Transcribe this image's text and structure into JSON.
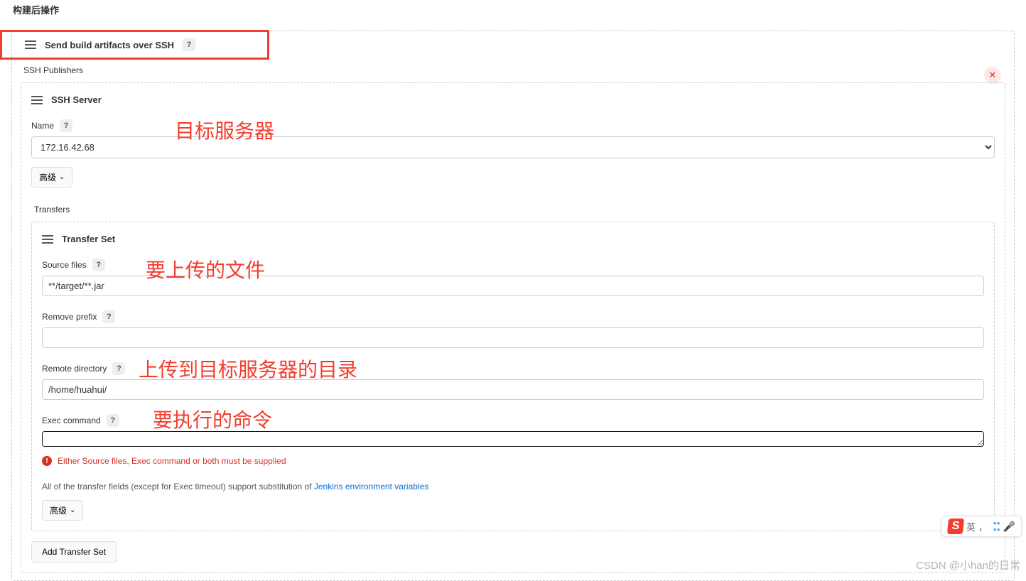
{
  "page": {
    "title": "构建后操作"
  },
  "section": {
    "title": "Send build artifacts over SSH",
    "publishers_label": "SSH Publishers"
  },
  "ssh_server": {
    "header": "SSH Server",
    "name_label": "Name",
    "name_value": "172.16.42.68",
    "advanced_label": "高级"
  },
  "transfers": {
    "label": "Transfers",
    "set_header": "Transfer Set",
    "source_files_label": "Source files",
    "source_files_value": "**/target/**.jar",
    "remove_prefix_label": "Remove prefix",
    "remove_prefix_value": "",
    "remote_dir_label": "Remote directory",
    "remote_dir_value": "/home/huahui/",
    "exec_cmd_label": "Exec command",
    "exec_cmd_value": "",
    "error_msg": "Either Source files, Exec command or both must be supplied",
    "help_text_prefix": "All of the transfer fields (except for Exec timeout) support substitution of ",
    "help_link": "Jenkins environment variables",
    "advanced_label": "高级",
    "add_button": "Add Transfer Set"
  },
  "annotations": {
    "target_server": "目标服务器",
    "files_to_upload": "要上传的文件",
    "remote_dir": "上传到目标服务器的目录",
    "exec_cmd": "要执行的命令"
  },
  "ime": {
    "logo": "S",
    "lang": "英",
    "comma": "，"
  },
  "watermark": "CSDN @小han的日常"
}
